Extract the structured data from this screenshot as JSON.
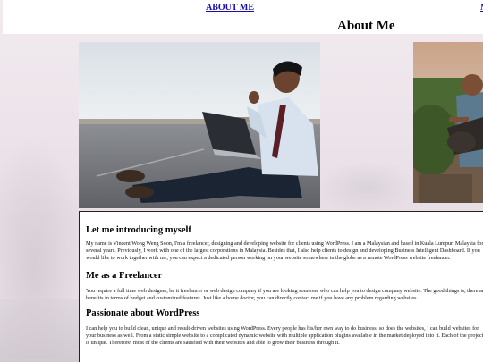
{
  "nav": {
    "about_label": "ABOUT ME",
    "next_label": "M"
  },
  "page": {
    "title": "About Me"
  },
  "photos": {
    "main_icon": "man-with-laptop-photo",
    "guitar_icon": "man-with-guitar-photo",
    "bottom_icon": "partial-photo"
  },
  "sections": [
    {
      "heading": "Let me introducing myself",
      "body": "My name is Vincent Wong Weng Soon, I'm a freelancer, designing and developing website for clients using WordPress. I am a Malaysian and based in Kuala Lumpur, Malaysia for several years. Previously, I work with one of the largest corporations in Malaysia. Besides that, I also help clients to design and developing Business Intelligent Dashboard. If you would like to work together with me, you can expect a dedicated person working on your website somewhere in the globe as a remote WordPress website freelancer."
    },
    {
      "heading": "Me as a Freelancer",
      "body": "You require a full time web designer, be it freelancer or web design company if you are looking someone who can help you to design company website. The good things is, there are benefits in terms of budget and customized features. Just like a home doctor, you can directly contact me if you have any problem regarding websites."
    },
    {
      "heading": "Passionate about WordPress",
      "body": "I can help you to build clean, unique and result-driven websites using WordPress. Every people has his/her own way to do business, so does the websites, I can build websites for your business as well. From a static simple website to a complicated dynamic website with multiple application plugins available in the market deployed into it. Each of the projects is unique. Therefore, most of the clients are satisfied with their websites and able to grow their business through it."
    }
  ],
  "colors": {
    "link": "#1a0dab",
    "background": "#ece4ea"
  }
}
